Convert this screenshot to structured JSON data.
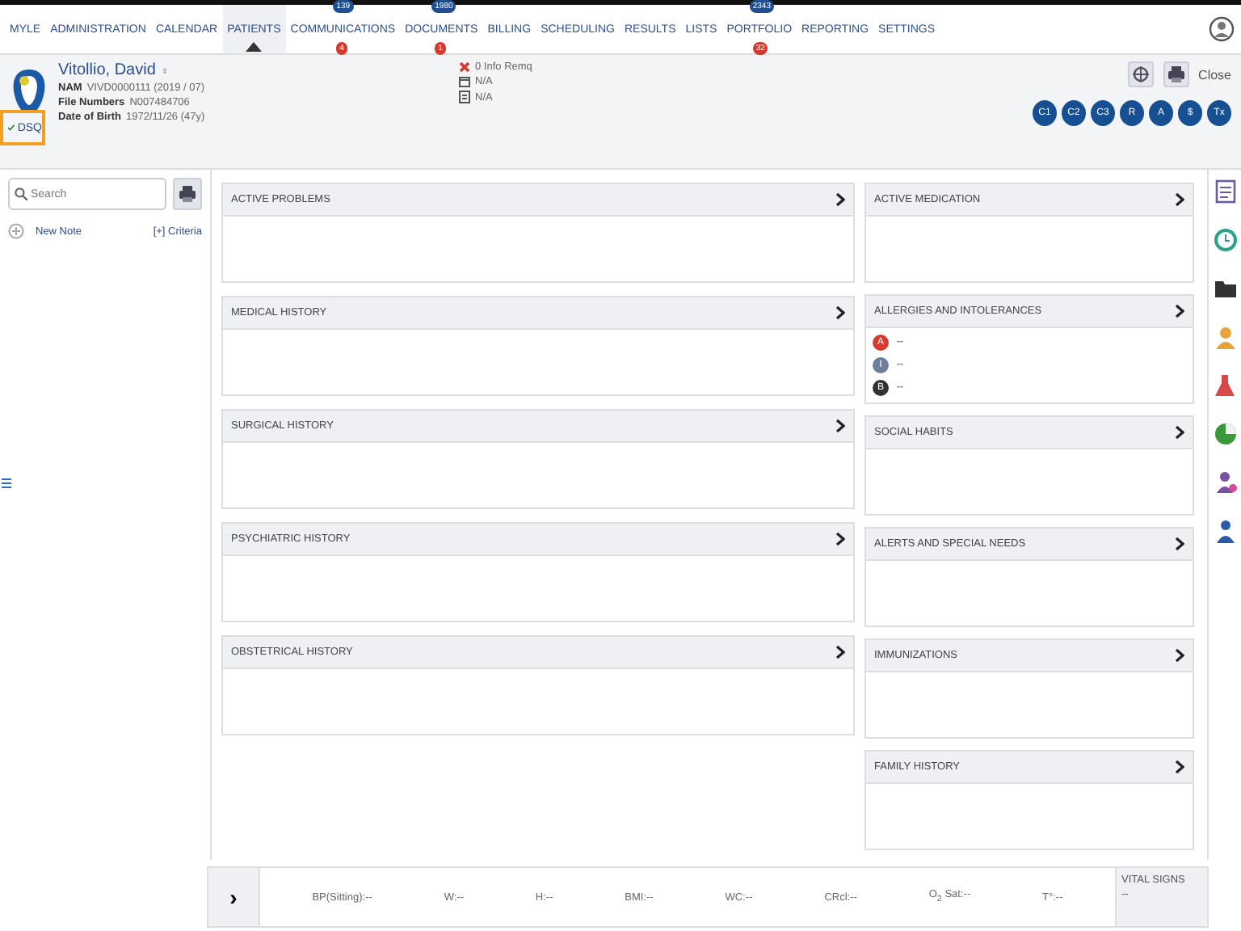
{
  "nav": [
    {
      "label": "MYLE",
      "selected": false
    },
    {
      "label": "ADMINISTRATION",
      "selected": false
    },
    {
      "label": "CALENDAR",
      "selected": false
    },
    {
      "label": "PATIENTS",
      "selected": true
    },
    {
      "label": "COMMUNICATIONS",
      "selected": false,
      "badge": "139",
      "alert": "4"
    },
    {
      "label": "DOCUMENTS",
      "selected": false,
      "badge": "1980",
      "alert": "1"
    },
    {
      "label": "BILLING",
      "selected": false
    },
    {
      "label": "SCHEDULING",
      "selected": false
    },
    {
      "label": "RESULTS",
      "selected": false
    },
    {
      "label": "LISTS",
      "selected": false
    },
    {
      "label": "PORTFOLIO",
      "selected": false,
      "badge": "2343",
      "alert": "32"
    },
    {
      "label": "REPORTING",
      "selected": false
    },
    {
      "label": "SETTINGS",
      "selected": false
    }
  ],
  "patient": {
    "name": "Vitollio, David",
    "sex": "♀",
    "fields": [
      {
        "label": "NAM",
        "value": "VIVD0000111 (2019 / 07)"
      },
      {
        "label": "File Numbers",
        "value": "N007484706"
      },
      {
        "label": "Date of Birth",
        "value": "1972/11/26 (47y)"
      }
    ],
    "status": "DSQ",
    "info": [
      {
        "kind": "alert",
        "text": "0 Info Remq"
      },
      {
        "kind": "calendar",
        "text": "N/A"
      },
      {
        "kind": "card",
        "text": "N/A"
      }
    ],
    "close": "Close",
    "circles": [
      "C1",
      "C2",
      "C3",
      "R",
      "A",
      "$",
      "Tx"
    ]
  },
  "sidebar": {
    "search": {
      "placeholder": "Search"
    },
    "new_note": "New Note",
    "criteria": "[+] Criteria"
  },
  "center_sections": [
    {
      "title": "ACTIVE PROBLEMS"
    },
    {
      "title": "MEDICAL HISTORY"
    },
    {
      "title": "SURGICAL HISTORY"
    },
    {
      "title": "PSYCHIATRIC HISTORY"
    },
    {
      "title": "OBSTETRICAL HISTORY"
    }
  ],
  "right_sections": [
    {
      "title": "ACTIVE MEDICATION"
    },
    {
      "title": "ALLERGIES AND INTOLERANCES",
      "items": [
        {
          "letter": "A",
          "value": "--",
          "color": "#d63a2f"
        },
        {
          "letter": "I",
          "value": "--",
          "color": "#6f7f99"
        },
        {
          "letter": "B",
          "value": "--",
          "color": "#333333"
        }
      ]
    },
    {
      "title": "SOCIAL HABITS"
    },
    {
      "title": "ALERTS AND SPECIAL NEEDS"
    },
    {
      "title": "IMMUNIZATIONS"
    },
    {
      "title": "FAMILY HISTORY"
    }
  ],
  "vitals": {
    "toggle": "›",
    "items": [
      "BP(Sitting):--",
      "W:--",
      "H:--",
      "BMI:--",
      "WC:--",
      "CRcl:--",
      "O$_{2}$ Sat:--",
      "T°:--"
    ],
    "title": "VITAL SIGNS",
    "value": "--"
  }
}
